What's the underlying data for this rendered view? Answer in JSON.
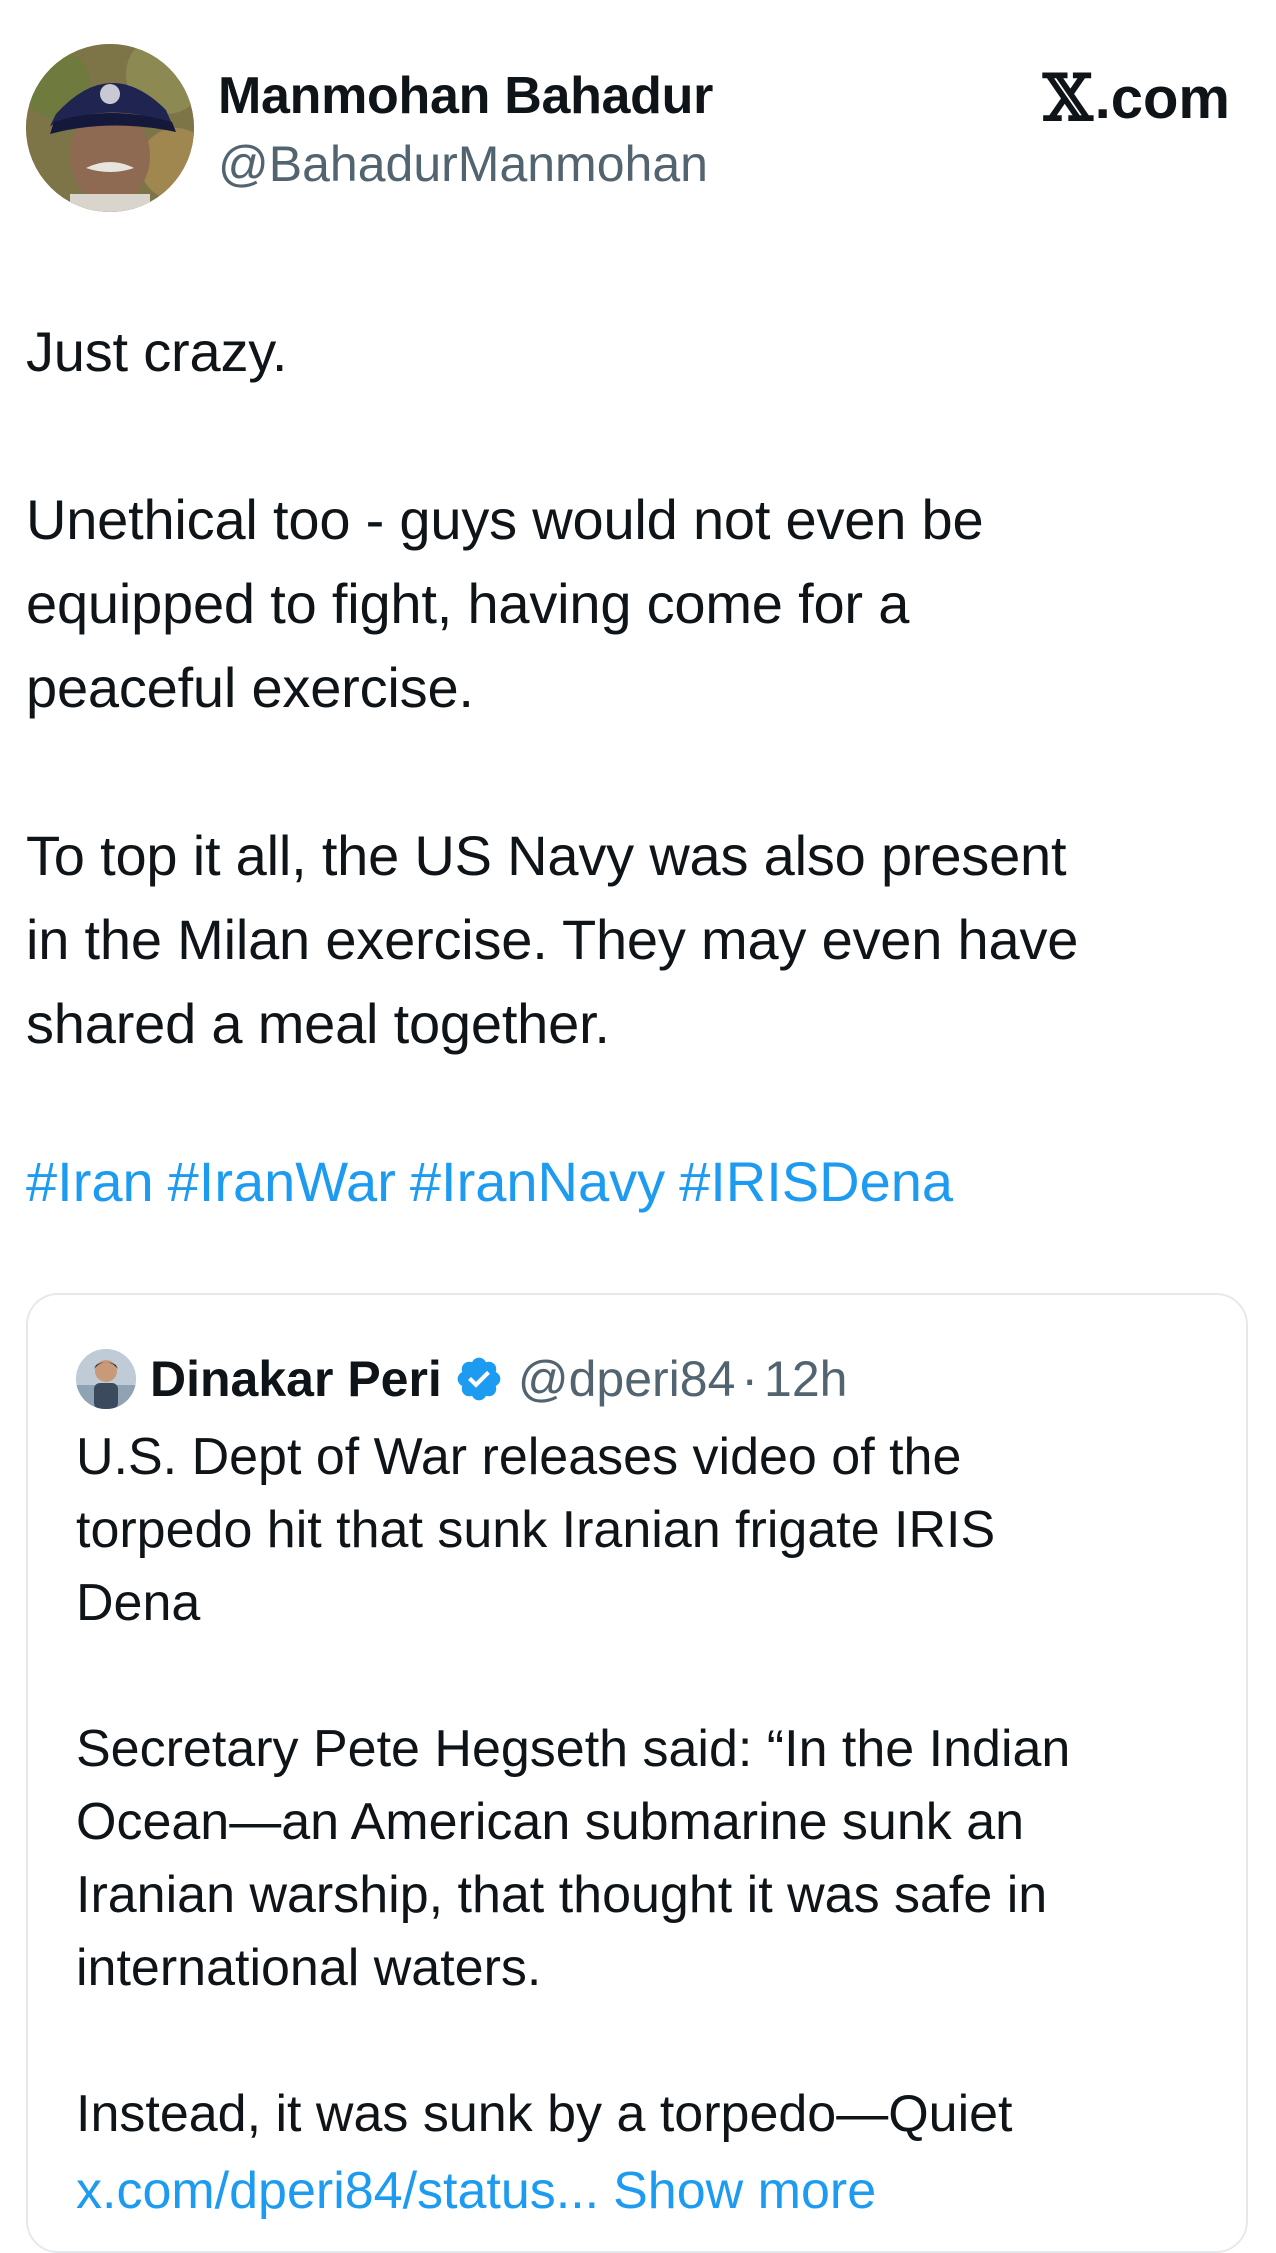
{
  "author": {
    "name": "Manmohan Bahadur",
    "handle": "@BahadurManmohan"
  },
  "brand": {
    "label": ".com",
    "icon": "x-logo-icon"
  },
  "tweet": {
    "paragraphs": [
      "Just crazy.",
      "Unethical too -  guys would not even be\nequipped to fight, having come for a\npeaceful exercise.",
      "To top it all, the US Navy was also present\nin the Milan exercise. They may even have\nshared a meal together."
    ],
    "hashtags": [
      "#Iran",
      "#IranWar",
      "#IranNavy",
      "#IRISDena"
    ]
  },
  "quote": {
    "author_name": "Dinakar Peri",
    "verified_icon": "verified-badge-icon",
    "handle": "@dperi84",
    "separator": "·",
    "time": "12h",
    "paragraphs": [
      "U.S. Dept of War releases video of the\ntorpedo hit that sunk Iranian frigate IRIS\nDena",
      "Secretary Pete Hegseth said: “In the Indian\nOcean—an American submarine sunk an\nIranian warship, that thought it was safe in\ninternational waters.",
      "Instead, it was sunk by a torpedo—Quiet"
    ],
    "link": "x.com/dperi84/status...",
    "show_more": "Show more"
  },
  "colors": {
    "text": "#0f1419",
    "secondary": "#536471",
    "link": "#1d9bf0",
    "border": "#e6e9ec"
  }
}
